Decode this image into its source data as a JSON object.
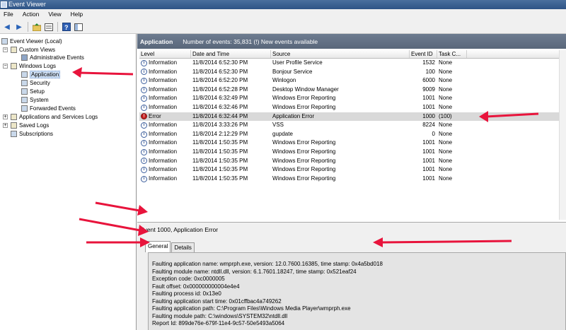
{
  "window": {
    "title": "Event Viewer"
  },
  "menu": [
    "File",
    "Action",
    "View",
    "Help"
  ],
  "tree": {
    "root": "Event Viewer (Local)",
    "custom_views": "Custom Views",
    "administrative_events": "Administrative Events",
    "windows_logs": "Windows Logs",
    "application": "Application",
    "security": "Security",
    "setup": "Setup",
    "system": "System",
    "forwarded_events": "Forwarded Events",
    "apps_services": "Applications and Services Logs",
    "saved_logs": "Saved Logs",
    "subscriptions": "Subscriptions"
  },
  "header": {
    "title": "Application",
    "summary": "Number of events: 35,831 (!) New events available"
  },
  "columns": {
    "level": "Level",
    "date": "Date and Time",
    "source": "Source",
    "event_id": "Event ID",
    "task": "Task C..."
  },
  "events": [
    {
      "level": "Information",
      "date": "11/8/2014 6:52:30 PM",
      "source": "User Profile Service",
      "id": "1532",
      "task": "None"
    },
    {
      "level": "Information",
      "date": "11/8/2014 6:52:30 PM",
      "source": "Bonjour Service",
      "id": "100",
      "task": "None"
    },
    {
      "level": "Information",
      "date": "11/8/2014 6:52:20 PM",
      "source": "Winlogon",
      "id": "6000",
      "task": "None"
    },
    {
      "level": "Information",
      "date": "11/8/2014 6:52:28 PM",
      "source": "Desktop Window Manager",
      "id": "9009",
      "task": "None"
    },
    {
      "level": "Information",
      "date": "11/8/2014 6:32:49 PM",
      "source": "Windows Error Reporting",
      "id": "1001",
      "task": "None"
    },
    {
      "level": "Information",
      "date": "11/8/2014 6:32:46 PM",
      "source": "Windows Error Reporting",
      "id": "1001",
      "task": "None"
    },
    {
      "level": "Error",
      "date": "11/8/2014 6:32:44 PM",
      "source": "Application Error",
      "id": "1000",
      "task": "(100)"
    },
    {
      "level": "Information",
      "date": "11/8/2014 3:33:26 PM",
      "source": "VSS",
      "id": "8224",
      "task": "None"
    },
    {
      "level": "Information",
      "date": "11/8/2014 2:12:29 PM",
      "source": "gupdate",
      "id": "0",
      "task": "None"
    },
    {
      "level": "Information",
      "date": "11/8/2014 1:50:35 PM",
      "source": "Windows Error Reporting",
      "id": "1001",
      "task": "None"
    },
    {
      "level": "Information",
      "date": "11/8/2014 1:50:35 PM",
      "source": "Windows Error Reporting",
      "id": "1001",
      "task": "None"
    },
    {
      "level": "Information",
      "date": "11/8/2014 1:50:35 PM",
      "source": "Windows Error Reporting",
      "id": "1001",
      "task": "None"
    },
    {
      "level": "Information",
      "date": "11/8/2014 1:50:35 PM",
      "source": "Windows Error Reporting",
      "id": "1001",
      "task": "None"
    },
    {
      "level": "Information",
      "date": "11/8/2014 1:50:35 PM",
      "source": "Windows Error Reporting",
      "id": "1001",
      "task": "None"
    }
  ],
  "detail": {
    "title": "Event 1000, Application Error",
    "tab_general": "General",
    "tab_details": "Details",
    "lines": [
      "Faulting application name: wmprph.exe, version: 12.0.7600.16385, time stamp: 0x4a5bd018",
      "Faulting module name: ntdll.dll, version: 6.1.7601.18247, time stamp: 0x521eaf24",
      "Exception code: 0xc0000005",
      "Fault offset: 0x000000000004e4e4",
      "Faulting process id: 0x13e0",
      "Faulting application start time: 0x01cffbac4a749262",
      "Faulting application path: C:\\Program Files\\Windows Media Player\\wmprph.exe",
      "Faulting module path: C:\\windows\\SYSTEM32\\ntdll.dll",
      "Report Id: 899de76e-679f-11e4-9c57-50e5493a5064"
    ]
  },
  "colors": {
    "annotation_arrow": "#e8143c",
    "error_icon": "#c42222",
    "header_bar": "#627186"
  },
  "icons": [
    "back-arrow-icon",
    "forward-arrow-icon",
    "folder-up-icon",
    "properties-icon",
    "help-icon",
    "panel-icon"
  ]
}
